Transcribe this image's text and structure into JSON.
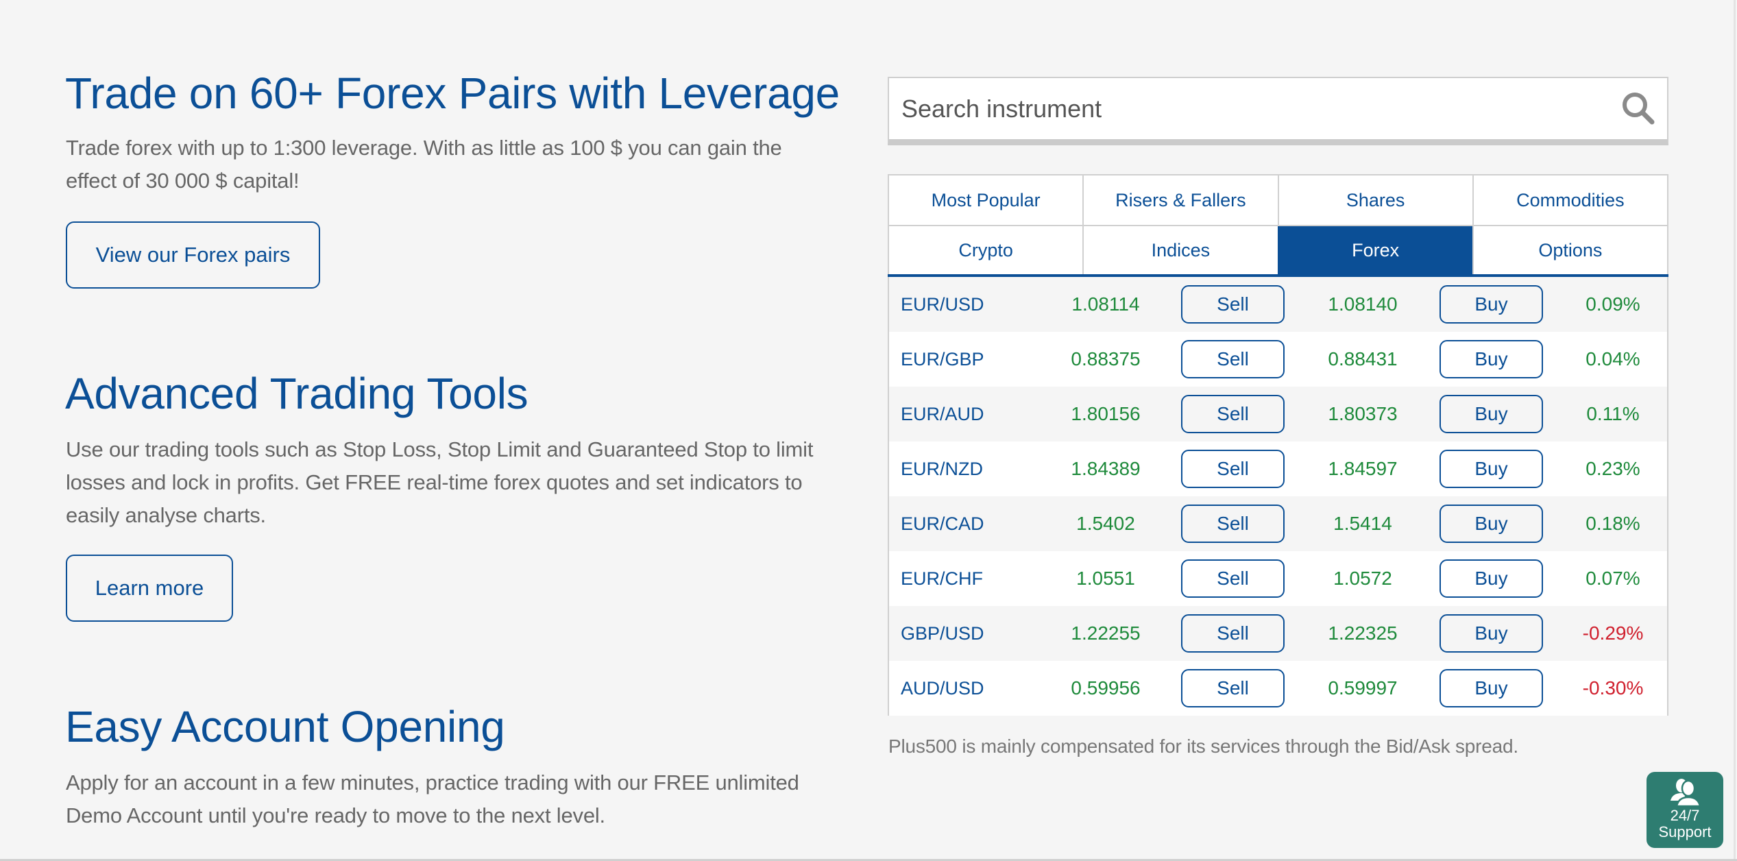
{
  "sections": [
    {
      "title": "Trade on 60+ Forex Pairs with Leverage",
      "paragraph_lines": [
        "Trade forex with up to 1:300 leverage. With as little as 100 $ you can gain the",
        "effect of 30 000 $ capital!"
      ],
      "button_label": "View our Forex pairs"
    },
    {
      "title": "Advanced Trading Tools",
      "paragraph_lines": [
        "Use our trading tools such as Stop Loss, Stop Limit and Guaranteed Stop to limit",
        "losses and lock in profits. Get FREE real-time forex quotes and set indicators to",
        "easily analyse charts."
      ],
      "button_label": "Learn more"
    },
    {
      "title": "Easy Account Opening",
      "paragraph_lines": [
        "Apply for an account in a few minutes, practice trading with our FREE unlimited",
        "Demo Account until you're ready to move to the next level."
      ]
    }
  ],
  "search": {
    "placeholder": "Search instrument",
    "value": "",
    "icon": "search-icon"
  },
  "tabs": {
    "rows": [
      [
        "Most Popular",
        "Risers & Fallers",
        "Shares",
        "Commodities"
      ],
      [
        "Crypto",
        "Indices",
        "Forex",
        "Options"
      ]
    ],
    "active": "Forex"
  },
  "instruments": [
    {
      "symbol": "EUR/USD",
      "sell": "1.08114",
      "sell_label": "Sell",
      "buy": "1.08140",
      "buy_label": "Buy",
      "change": "0.09%",
      "direction": "up"
    },
    {
      "symbol": "EUR/GBP",
      "sell": "0.88375",
      "sell_label": "Sell",
      "buy": "0.88431",
      "buy_label": "Buy",
      "change": "0.04%",
      "direction": "up"
    },
    {
      "symbol": "EUR/AUD",
      "sell": "1.80156",
      "sell_label": "Sell",
      "buy": "1.80373",
      "buy_label": "Buy",
      "change": "0.11%",
      "direction": "up"
    },
    {
      "symbol": "EUR/NZD",
      "sell": "1.84389",
      "sell_label": "Sell",
      "buy": "1.84597",
      "buy_label": "Buy",
      "change": "0.23%",
      "direction": "up"
    },
    {
      "symbol": "EUR/CAD",
      "sell": "1.5402",
      "sell_label": "Sell",
      "buy": "1.5414",
      "buy_label": "Buy",
      "change": "0.18%",
      "direction": "up"
    },
    {
      "symbol": "EUR/CHF",
      "sell": "1.0551",
      "sell_label": "Sell",
      "buy": "1.0572",
      "buy_label": "Buy",
      "change": "0.07%",
      "direction": "up"
    },
    {
      "symbol": "GBP/USD",
      "sell": "1.22255",
      "sell_label": "Sell",
      "buy": "1.22325",
      "buy_label": "Buy",
      "change": "-0.29%",
      "direction": "down"
    },
    {
      "symbol": "AUD/USD",
      "sell": "0.59956",
      "sell_label": "Sell",
      "buy": "0.59997",
      "buy_label": "Buy",
      "change": "-0.30%",
      "direction": "down"
    }
  ],
  "footnote": "Plus500 is mainly compensated for its services through the Bid/Ask spread.",
  "support": {
    "icon": "support-agents-icon",
    "line1": "24/7",
    "line2": "Support"
  },
  "colors": {
    "brand_blue": "#0b4f96",
    "positive": "#1e8a3b",
    "negative": "#d0202e",
    "support_bg": "#2e7d71",
    "page_bg": "#f5f5f5"
  }
}
